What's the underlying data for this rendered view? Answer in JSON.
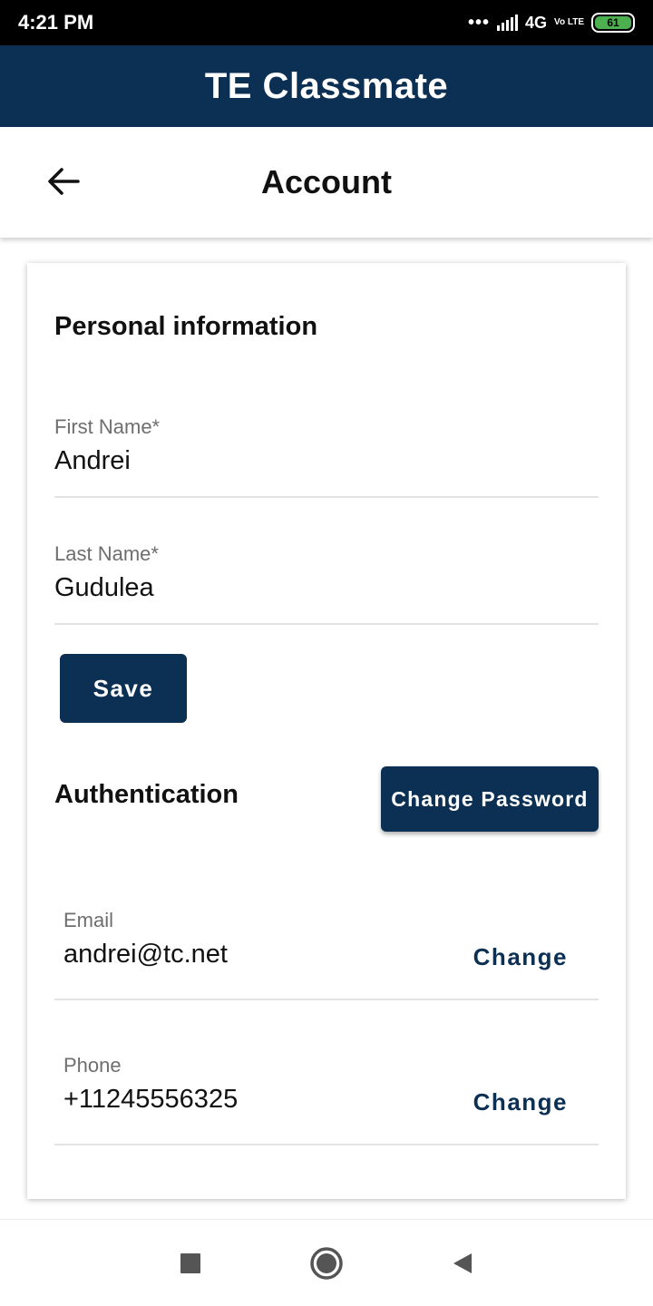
{
  "status_bar": {
    "time": "4:21 PM",
    "dots": "•••",
    "network": "4G",
    "volte": "Vo LTE",
    "battery": "61"
  },
  "app": {
    "title": "TE Classmate"
  },
  "toolbar": {
    "title": "Account",
    "back_icon": "arrow-left-icon"
  },
  "personal": {
    "heading": "Personal information",
    "first_name_label": "First Name*",
    "first_name_value": "Andrei",
    "last_name_label": "Last Name*",
    "last_name_value": "Gudulea",
    "save_label": "Save"
  },
  "authentication": {
    "heading": "Authentication",
    "change_password_label": "Change Password",
    "email_label": "Email",
    "email_value": "andrei@tc.net",
    "email_change": "Change",
    "phone_label": "Phone",
    "phone_value": "+11245556325",
    "phone_change": "Change"
  },
  "nav": {
    "recents_icon": "square-icon",
    "home_icon": "circle-icon",
    "back_icon": "triangle-back-icon"
  },
  "colors": {
    "brand": "#0c3054",
    "battery": "#4caf50"
  }
}
